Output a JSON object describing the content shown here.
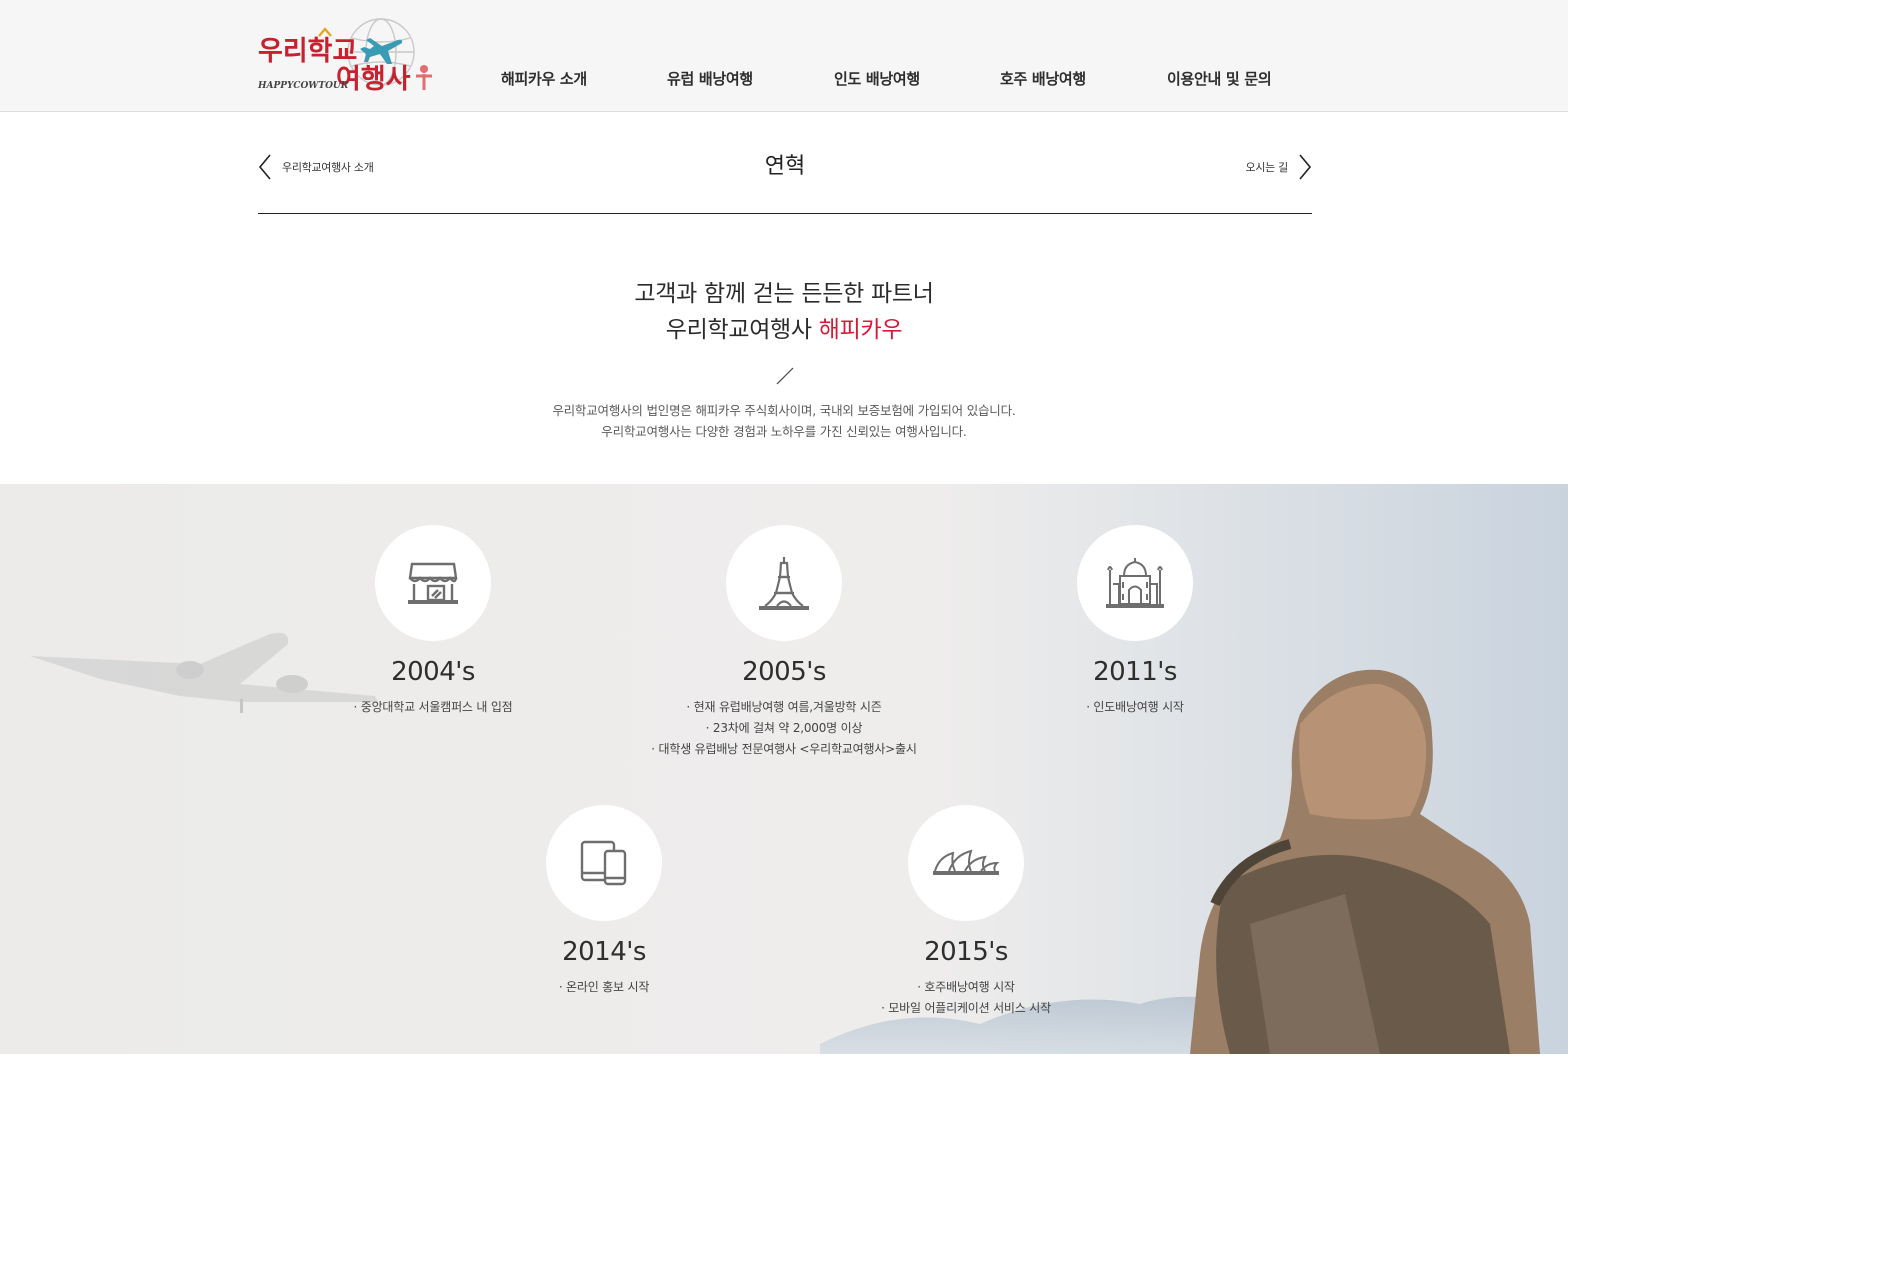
{
  "logo": {
    "text_main": "우리학교",
    "text_sub": "여행사",
    "text_en": "HAPPYCOWTOUR"
  },
  "nav": {
    "items": [
      {
        "label": "해피카우 소개"
      },
      {
        "label": "유럽 배낭여행"
      },
      {
        "label": "인도 배낭여행"
      },
      {
        "label": "호주 배낭여행"
      },
      {
        "label": "이용안내 및 문의"
      }
    ]
  },
  "subnav": {
    "prev_label": "우리학교여행사 소개",
    "title": "연혁",
    "next_label": "오시는 길"
  },
  "intro": {
    "line1": "고객과 함께 걷는 든든한 파트너",
    "line2_plain": "우리학교여행사 ",
    "line2_accent": "해피카우",
    "desc1": "우리학교여행사의 법인명은 해피카우 주식회사이며, 국내외 보증보험에 가입되어 있습니다.",
    "desc2": "우리학교여행사는 다양한 경험과 노하우를 가진 신뢰있는 여행사입니다."
  },
  "colors": {
    "accent": "#d21c3a",
    "header_bg": "#f6f6f6",
    "icon": "#6e6e6e"
  },
  "history": [
    {
      "year": "2004's",
      "icon": "store-icon",
      "events": [
        "· 중앙대학교 서울캠퍼스 내 입점"
      ]
    },
    {
      "year": "2005's",
      "icon": "eiffel-tower-icon",
      "events": [
        "· 현재 유럽배낭여행 여름,겨울방학 시즌",
        "· 23차에 걸쳐 약 2,000명 이상",
        "· 대학생 유럽배낭 전문여행사 <우리학교여행사>출시"
      ]
    },
    {
      "year": "2011's",
      "icon": "taj-mahal-icon",
      "events": [
        "· 인도배낭여행 시작"
      ]
    },
    {
      "year": "2014's",
      "icon": "devices-icon",
      "events": [
        "· 온라인 홍보 시작"
      ]
    },
    {
      "year": "2015's",
      "icon": "opera-house-icon",
      "events": [
        "· 호주배낭여행 시작",
        "· 모바일 어플리케이션 서비스 시작"
      ]
    }
  ]
}
